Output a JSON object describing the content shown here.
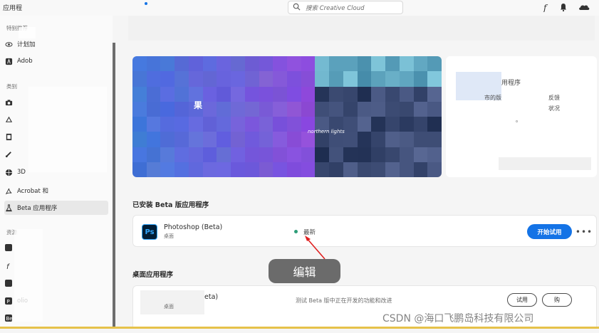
{
  "topbar": {
    "app_title": "应用程",
    "search_placeholder": "搜索 Creative Cloud"
  },
  "sidebar": {
    "section_featured": "特别推荐",
    "featured_items": [
      {
        "label": "计划加",
        "icon": "eye-icon"
      },
      {
        "label": "Adob",
        "icon": "adobe-icon"
      }
    ],
    "section_categories": "类别",
    "category_items": [
      {
        "label": "",
        "icon": "camera-icon"
      },
      {
        "label": "",
        "icon": "shape-icon"
      },
      {
        "label": "",
        "icon": "film-icon"
      },
      {
        "label": "",
        "icon": "brush-icon"
      },
      {
        "label": "3D",
        "icon": "cube-icon"
      },
      {
        "label": "Acrobat 和",
        "icon": "acrobat-icon"
      },
      {
        "label": "Beta 应用程序",
        "icon": "flask-icon"
      }
    ],
    "section_resources": "资源",
    "resource_labels": [
      "",
      "",
      "",
      "olio",
      ""
    ]
  },
  "banner": {
    "label": "果",
    "sub": "northern lights"
  },
  "side_card": {
    "title": "用程序",
    "line1": "市的版",
    "line2": "反馈",
    "line3": "状况",
    "line4": "。"
  },
  "installed_section": {
    "heading": "已安装 Beta 版应用程序",
    "app": {
      "name": "Photoshop (Beta)",
      "sub": "桌面",
      "icon_text": "Ps",
      "status": "最新",
      "start_button": "开始试用",
      "more": "•••"
    }
  },
  "desktop_section": {
    "heading": "桌面应用程序",
    "app": {
      "name": "eta)",
      "sub": "桌面",
      "desc": "测试 Beta 版中正在开发的功能和改进",
      "try_button": "试用",
      "buy_button": "购"
    }
  },
  "annotation": {
    "label": "编辑"
  },
  "watermark": "CSDN @海口飞鹏岛科技有限公司",
  "colors": {
    "accent": "#1473e6",
    "status_green": "#2d9d78",
    "ps_dark": "#001e36",
    "ps_blue": "#31a8ff"
  }
}
